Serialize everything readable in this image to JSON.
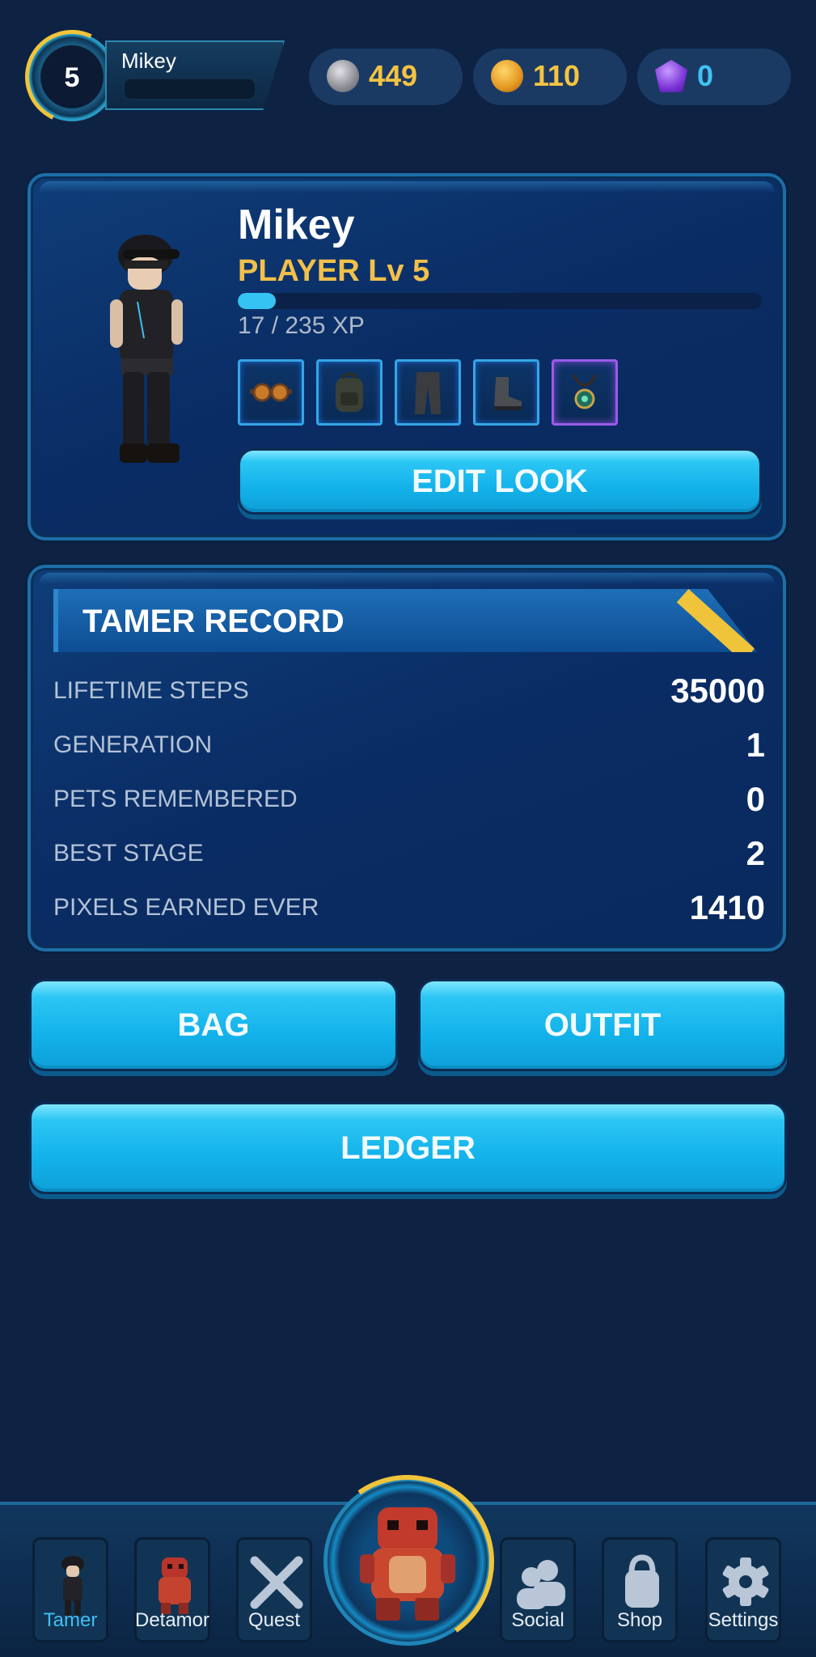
{
  "header": {
    "level": "5",
    "player_name": "Mikey",
    "currencies": [
      {
        "icon": "silver-coin-icon",
        "value": "449",
        "color": "#f3c443"
      },
      {
        "icon": "gold-coin-icon",
        "value": "110",
        "color": "#f3c443"
      },
      {
        "icon": "gem-icon",
        "value": "0",
        "color": "#3fc3f2"
      }
    ]
  },
  "profile": {
    "name": "Mikey",
    "level_label": "PLAYER Lv 5",
    "xp_text": "17 / 235 XP",
    "xp_fraction": 0.072,
    "equipment": [
      "goggles",
      "backpack",
      "pants",
      "boots",
      "amulet"
    ],
    "edit_button": "EDIT LOOK"
  },
  "record": {
    "title": "TAMER RECORD",
    "rows": [
      {
        "label": "LIFETIME STEPS",
        "value": "35000"
      },
      {
        "label": "GENERATION",
        "value": "1"
      },
      {
        "label": "PETS REMEMBERED",
        "value": "0"
      },
      {
        "label": "BEST STAGE",
        "value": "2"
      },
      {
        "label": "PIXELS EARNED EVER",
        "value": "1410"
      }
    ]
  },
  "actions": {
    "bag": "BAG",
    "outfit": "OUTFIT",
    "ledger": "LEDGER"
  },
  "nav": {
    "items": [
      {
        "label": "Tamer",
        "icon": "tamer-icon",
        "active": true
      },
      {
        "label": "Detamor",
        "icon": "detamor-icon",
        "active": false
      },
      {
        "label": "Quest",
        "icon": "quest-icon",
        "active": false
      },
      {
        "label": "Social",
        "icon": "social-icon",
        "active": false
      },
      {
        "label": "Shop",
        "icon": "shop-icon",
        "active": false
      },
      {
        "label": "Settings",
        "icon": "settings-icon",
        "active": false
      }
    ],
    "center_icon": "pet-icon"
  },
  "colors": {
    "accent": "#13b2ea",
    "gold": "#f2c04a",
    "background": "#0e2244"
  }
}
